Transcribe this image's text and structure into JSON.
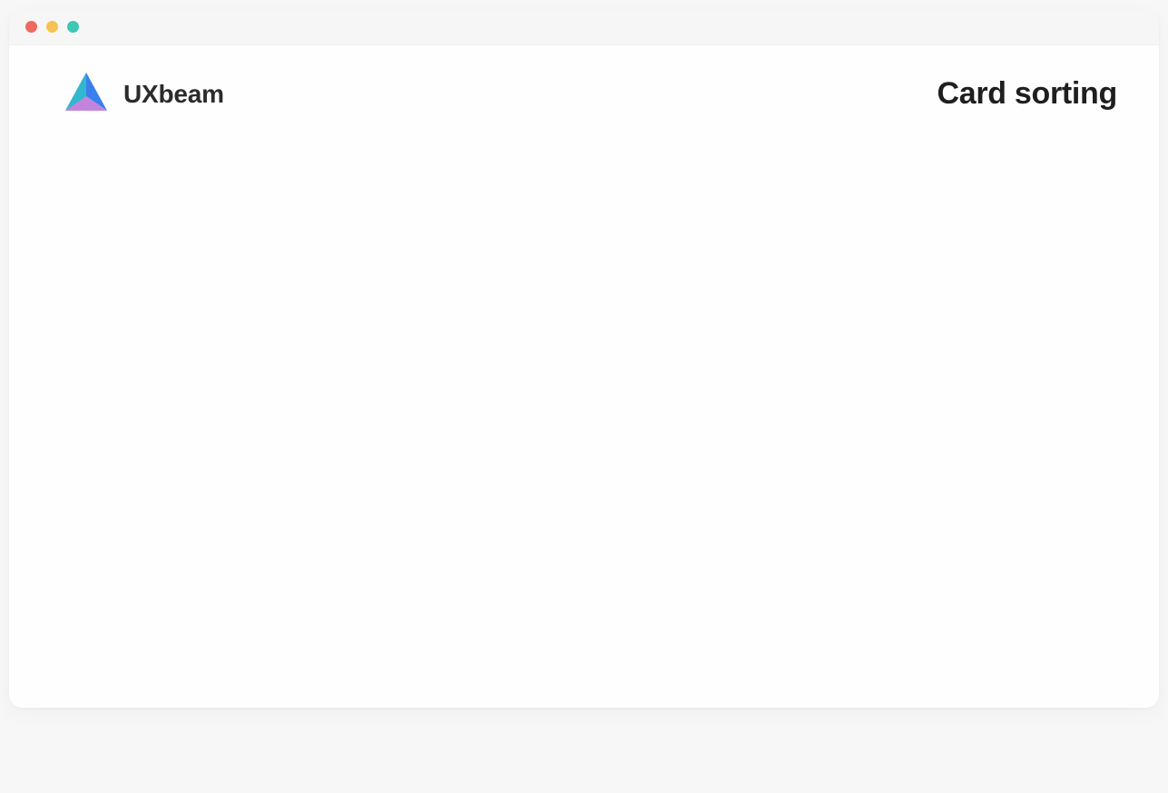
{
  "window": {
    "traffic_lights": {
      "close_color": "#ed6a5e",
      "minimize_color": "#f6c250",
      "maximize_color": "#3ec6b8"
    }
  },
  "header": {
    "brand_name": "UXbeam",
    "page_title": "Card sorting"
  }
}
